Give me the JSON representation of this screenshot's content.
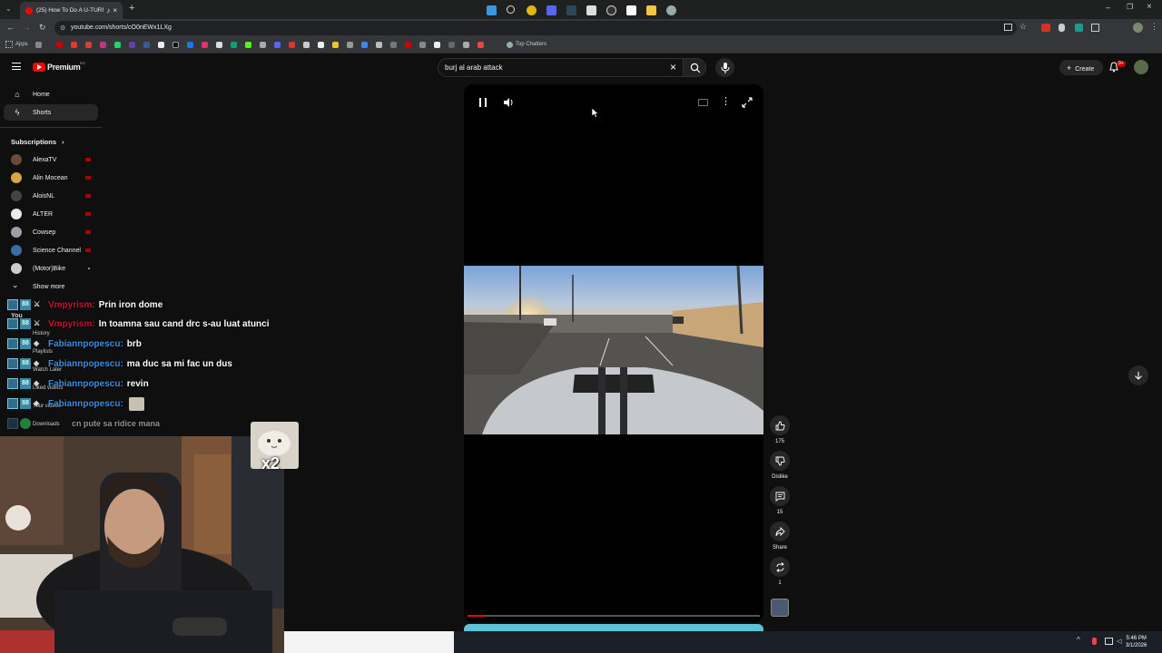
{
  "browser": {
    "tab_title": "(25) How To Do A U-TURN",
    "url": "youtube.com/shorts/cO0nEWx1LXg",
    "bookmarks": {
      "apps": "Apps",
      "top_chatters": "Top Chatters"
    }
  },
  "header": {
    "logo_text": "Premium",
    "logo_region": "RO",
    "search_value": "burj al arab attack",
    "create_label": "Create",
    "notif_count": "9+"
  },
  "sidebar": {
    "home": "Home",
    "shorts": "Shorts",
    "subscriptions": "Subscriptions",
    "channels": [
      {
        "name": "AlexaTV",
        "color": "#6b4a3a"
      },
      {
        "name": "Alin Mocean",
        "color": "#d9a441"
      },
      {
        "name": "AloisNL",
        "color": "#444444"
      },
      {
        "name": "ALTER",
        "color": "#e9e9e9"
      },
      {
        "name": "Cowsep",
        "color": "#9aa0a6"
      },
      {
        "name": "Science Channel",
        "color": "#3a6ea5"
      },
      {
        "name": "(Motor)Bike",
        "color": "#cccccc"
      }
    ],
    "show_more": "Show more",
    "you": "You",
    "history": "History",
    "playlists": "Playlists",
    "watch_later": "Watch Later",
    "liked_videos": "Liked videos",
    "your_videos": "Your videos",
    "downloads": "Downloads"
  },
  "chat": [
    {
      "user": "Vmpyrism:",
      "msg": "Prin iron dome",
      "color": "#c8102e"
    },
    {
      "user": "Vmpyrism:",
      "msg": "In toamna sau cand drc s-au luat atunci",
      "color": "#c8102e"
    },
    {
      "user": "Fabiannpopescu:",
      "msg": "brb",
      "color": "#3c8de0"
    },
    {
      "user": "Fabiannpopescu:",
      "msg": "ma duc sa mi fac un dus",
      "color": "#3c8de0"
    },
    {
      "user": "Fabiannpopescu:",
      "msg": "revin",
      "color": "#3c8de0"
    },
    {
      "user": "Fabiannpopescu:",
      "msg": "",
      "color": "#3c8de0"
    },
    {
      "user": "",
      "msg": "cn pute sa ridice mana",
      "color": "#aaaaaa"
    }
  ],
  "badges": {
    "num": "88"
  },
  "emote": {
    "multiplier": "x2"
  },
  "player": {
    "progress": 0.06
  },
  "actions": {
    "likes": "175",
    "dislike": "Dislike",
    "comments": "15",
    "share": "Share",
    "remix": "1"
  },
  "taskbar": {
    "time": "5:46 PM",
    "date": "3/1/2026"
  }
}
